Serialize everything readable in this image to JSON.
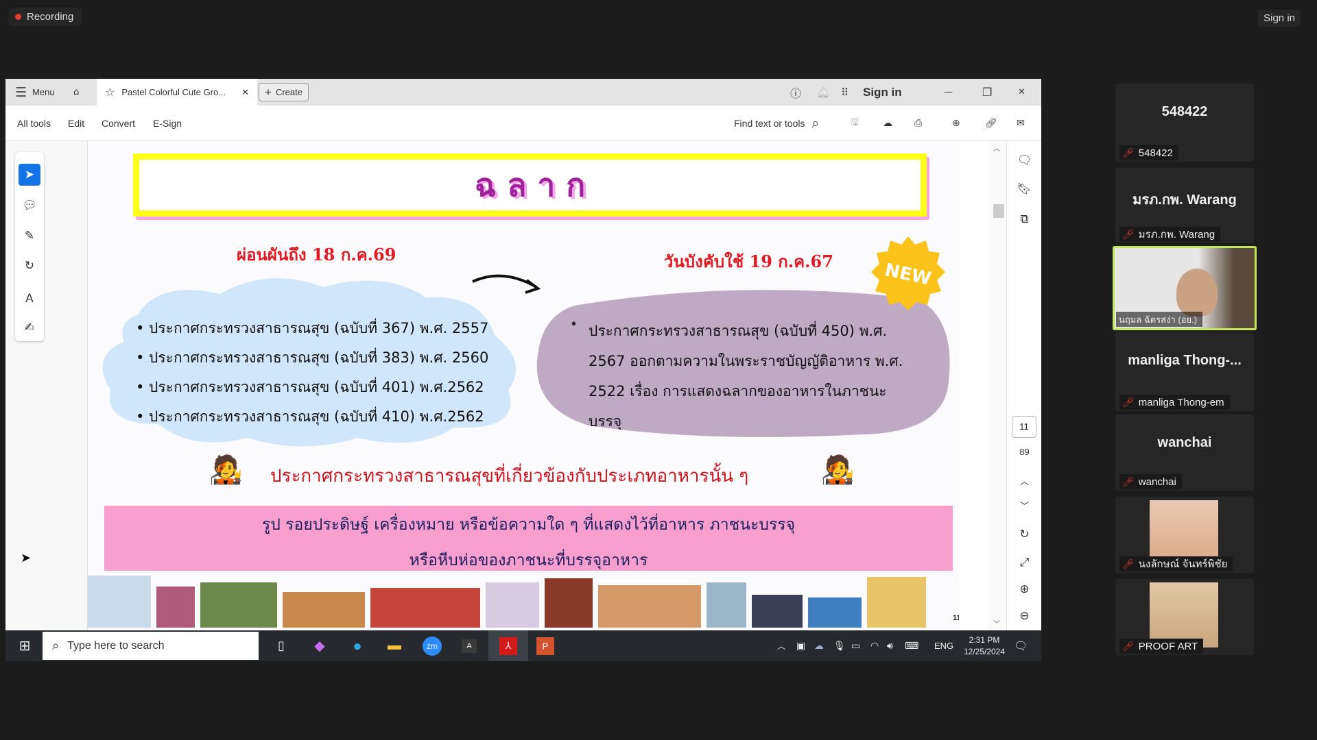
{
  "recording": {
    "label": "Recording"
  },
  "top_sign_in": "Sign in",
  "acrobat": {
    "menu_label": "Menu",
    "tab_title": "Pastel Colorful Cute Gro...",
    "create_label": "Create",
    "sign_in": "Sign in",
    "toolbar": {
      "items": [
        "All tools",
        "Edit",
        "Convert",
        "E-Sign"
      ],
      "find_placeholder": "Find text or tools"
    },
    "page_current": "11",
    "page_total": "89"
  },
  "slide": {
    "title": "ฉ ล า ก",
    "left_heading": "ผ่อนผันถึง 18 ก.ค.69",
    "left_items": [
      "ประกาศกระทรวงสาธารณสุข (ฉบับที่ 367) พ.ศ. 2557",
      "ประกาศกระทรวงสาธารณสุข (ฉบับที่ 383) พ.ศ. 2560",
      "ประกาศกระทรวงสาธารณสุข (ฉบับที่ 401) พ.ศ.2562",
      "ประกาศกระทรวงสาธารณสุข (ฉบับที่ 410) พ.ศ.2562"
    ],
    "right_heading": "วันบังคับใช้ 19 ก.ค.67",
    "new_badge": "NEW",
    "right_lines": [
      "ประกาศกระทรวงสาธารณสุข (ฉบับที่ 450) พ.ศ.",
      "2567 ออกตามความในพระราชบัญญัติอาหาร พ.ศ.",
      "2522 เรื่อง การแสดงฉลากของอาหารในภาชนะ",
      "บรรจุ"
    ],
    "subheading": "ประกาศกระทรวงสาธารณสุขที่เกี่ยวข้องกับประเภทอาหารนั้น ๆ",
    "band_lines": [
      "รูป  รอยประดิษฐ์  เครื่องหมาย หรือข้อความใด ๆ ที่แสดงไว้ที่อาหาร  ภาชนะบรรจุ",
      "หรือหีบห่อของภาชนะที่บรรจุอาหาร"
    ],
    "slide_number": "11",
    "colors": {
      "title": "#a0229a",
      "heading_red": "#e01b24",
      "band": "#f99fd0",
      "cloud": "#cfe6fb",
      "blob": "#bfaac4",
      "badge": "#fbc21a"
    }
  },
  "taskbar": {
    "search_placeholder": "Type here to search",
    "lang": "ENG",
    "time": "2:31 PM",
    "date": "12/25/2024"
  },
  "participants": [
    {
      "display": "548422",
      "name": "548422",
      "muted": true
    },
    {
      "display": "มรภ.กพ. Warang",
      "name": "มรภ.กพ. Warang",
      "muted": true
    },
    {
      "display": "",
      "name": "นฤมล ฉัตรสง่า (อย.)",
      "video": true,
      "active_speaker": true
    },
    {
      "display": "manliga  Thong-...",
      "name": "manliga Thong-em",
      "muted": true
    },
    {
      "display": "wanchai",
      "name": "wanchai",
      "muted": true
    },
    {
      "display": "",
      "name": "นงลักษณ์ จันทร์พิชัย",
      "muted": true,
      "photo": true
    },
    {
      "display": "",
      "name": "PROOF ART",
      "muted": true,
      "photo": true
    }
  ]
}
